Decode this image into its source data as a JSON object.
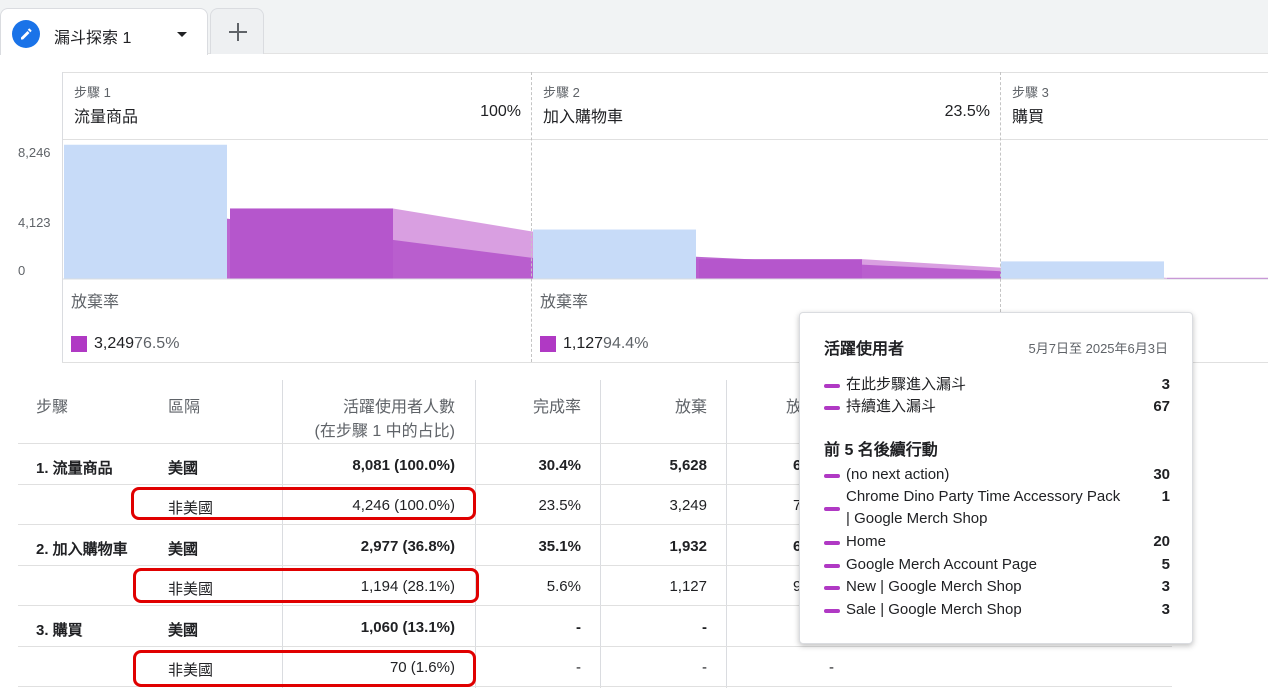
{
  "tabs": {
    "active_label": "漏斗探索 1"
  },
  "chart": {
    "y_ticks": [
      "8,246",
      "4,123",
      "0"
    ],
    "steps": [
      {
        "sub": "步驟 1",
        "name": "流量商品",
        "pct": "100%"
      },
      {
        "sub": "步驟 2",
        "name": "加入購物車",
        "pct": "23.5%"
      },
      {
        "sub": "步驟 3",
        "name": "購買",
        "pct": ""
      }
    ],
    "abandon_label": "放棄率",
    "abandon": [
      {
        "count": "3,249",
        "pct": "76.5%"
      },
      {
        "count": "1,127",
        "pct": "94.4%"
      }
    ],
    "colors": {
      "segment_a": "#c7dbf8",
      "segment_b": "#b556cc",
      "connector": "#d595de"
    }
  },
  "chart_data": {
    "type": "bar",
    "categories": [
      "流量商品",
      "加入購物車",
      "購買"
    ],
    "series": [
      {
        "name": "美國",
        "values": [
          8081,
          2977,
          1060
        ]
      },
      {
        "name": "非美國",
        "values": [
          4246,
          1194,
          70
        ]
      }
    ],
    "ylim": [
      0,
      8246
    ]
  },
  "table": {
    "headers": {
      "step": "步驟",
      "segment": "區隔",
      "users_line1": "活躍使用者人數",
      "users_line2": "(在步驟 1 中的占比)",
      "completion": "完成率",
      "abandon": "放棄",
      "abandon_rate_partial": "放"
    },
    "rows": [
      {
        "step": "1. 流量商品",
        "segment": "美國",
        "users": "8,081 (100.0%)",
        "completion": "30.4%",
        "abandon": "5,628",
        "rate": "6"
      },
      {
        "step": "",
        "segment": "非美國",
        "users": "4,246 (100.0%)",
        "completion": "23.5%",
        "abandon": "3,249",
        "rate": "7"
      },
      {
        "step": "2. 加入購物車",
        "segment": "美國",
        "users": "2,977 (36.8%)",
        "completion": "35.1%",
        "abandon": "1,932",
        "rate": "6"
      },
      {
        "step": "",
        "segment": "非美國",
        "users": "1,194 (28.1%)",
        "completion": "5.6%",
        "abandon": "1,127",
        "rate": "9"
      },
      {
        "step": "3. 購買",
        "segment": "美國",
        "users": "1,060 (13.1%)",
        "completion": "-",
        "abandon": "-",
        "rate": ""
      },
      {
        "step": "",
        "segment": "非美國",
        "users": "70 (1.6%)",
        "completion": "-",
        "abandon": "-",
        "rate": "-"
      }
    ]
  },
  "tooltip": {
    "title": "活躍使用者",
    "date": "5月7日至 2025年6月3日",
    "entries": [
      {
        "label": "在此步驟進入漏斗",
        "value": "3"
      },
      {
        "label": "持續進入漏斗",
        "value": "67"
      }
    ],
    "section_title": "前 5 名後續行動",
    "actions": [
      {
        "label": "(no next action)",
        "value": "30"
      },
      {
        "label": "Chrome Dino Party Time Accessory Pack | Google Merch Shop",
        "value": "1"
      },
      {
        "label": "Home",
        "value": "20"
      },
      {
        "label": "Google Merch Account Page",
        "value": "5"
      },
      {
        "label": "New | Google Merch Shop",
        "value": "3"
      },
      {
        "label": "Sale | Google Merch Shop",
        "value": "3"
      }
    ]
  }
}
